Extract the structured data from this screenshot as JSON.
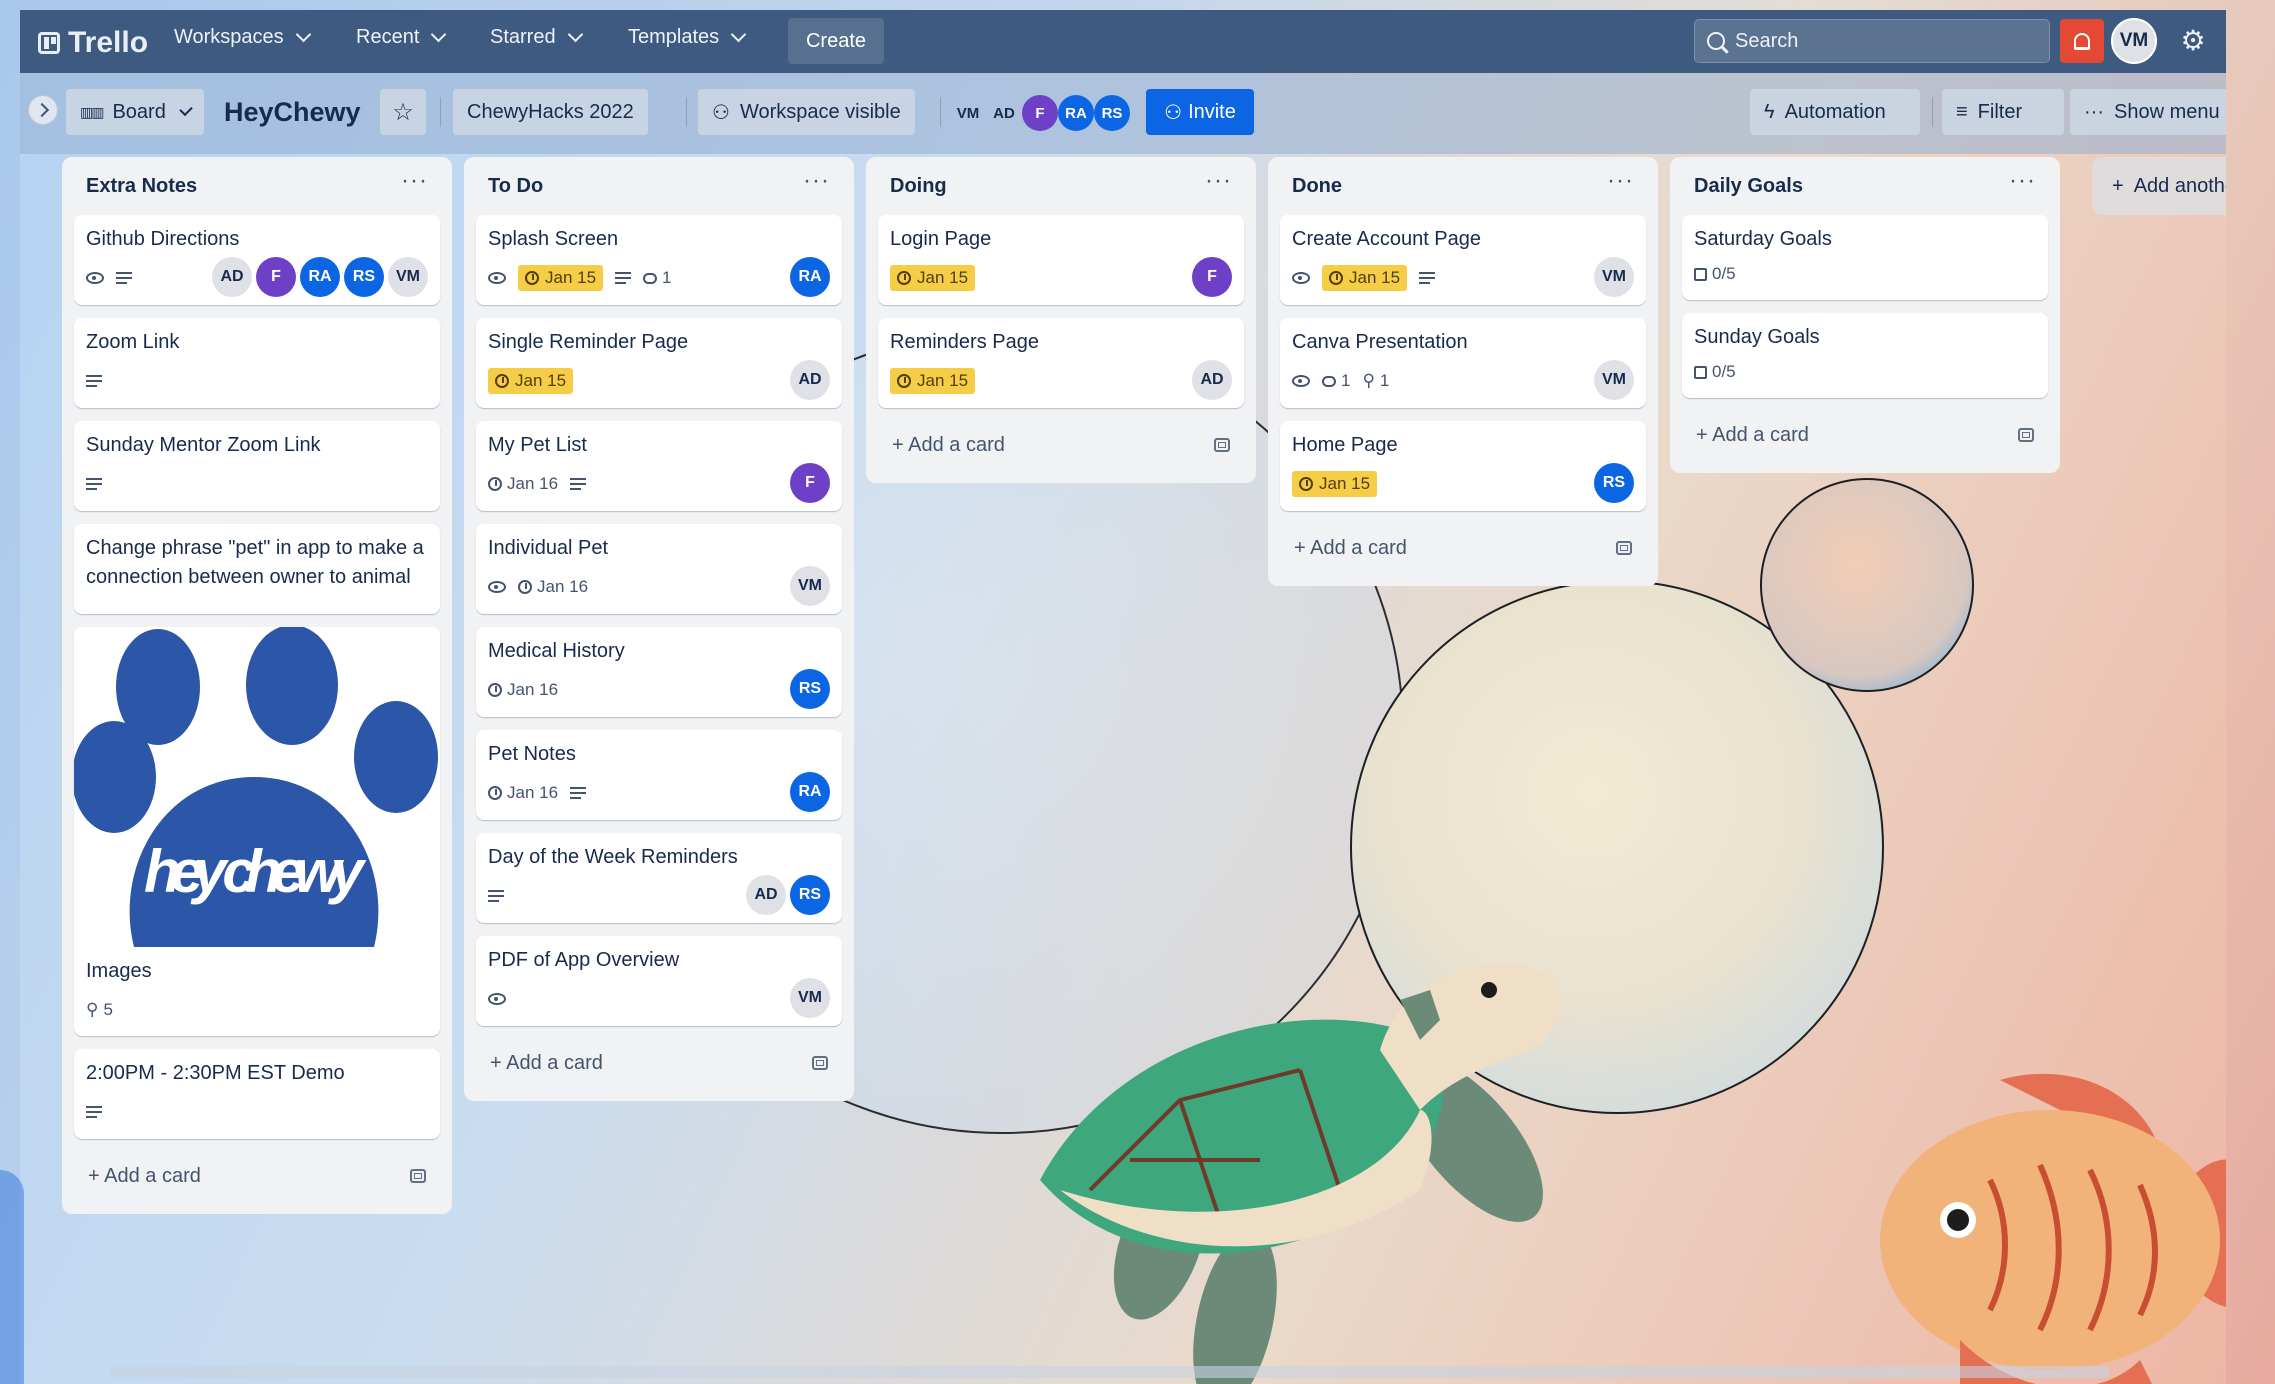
{
  "nav": {
    "logo": "Trello",
    "workspaces": "Workspaces",
    "recent": "Recent",
    "starred": "Starred",
    "templates": "Templates",
    "create": "Create",
    "search_placeholder": "Search",
    "avatar": "VM"
  },
  "board": {
    "view": "Board",
    "title": "HeyChewy",
    "workspace": "ChewyHacks 2022",
    "visibility": "Workspace visible",
    "members": [
      "VM",
      "AD",
      "F",
      "RA",
      "RS"
    ],
    "invite": "Invite",
    "automation": "Automation",
    "filter": "Filter",
    "show_menu": "Show menu"
  },
  "lists": [
    {
      "title": "Extra Notes",
      "cards": [
        {
          "title": "Github Directions",
          "members": [
            "AD",
            "F",
            "RA",
            "RS",
            "VM"
          ]
        },
        {
          "title": "Zoom Link"
        },
        {
          "title": "Sunday Mentor Zoom Link"
        },
        {
          "title": "Change phrase \"pet\" in app to make a connection between owner to animal"
        },
        {
          "title": "Images",
          "attachments": "5",
          "cover_text": "hey chewy"
        },
        {
          "title": "2:00PM - 2:30PM EST Demo"
        }
      ]
    },
    {
      "title": "To Do",
      "cards": [
        {
          "title": "Splash Screen",
          "date": "Jan 15",
          "comments": "1",
          "members": [
            "RA"
          ]
        },
        {
          "title": "Single Reminder Page",
          "date": "Jan 15",
          "members": [
            "AD"
          ]
        },
        {
          "title": "My Pet List",
          "date": "Jan 16",
          "members": [
            "F"
          ]
        },
        {
          "title": "Individual Pet",
          "date": "Jan 16",
          "members": [
            "VM"
          ]
        },
        {
          "title": "Medical History",
          "date": "Jan 16",
          "members": [
            "RS"
          ]
        },
        {
          "title": "Pet Notes",
          "date": "Jan 16",
          "members": [
            "RA"
          ]
        },
        {
          "title": "Day of the Week Reminders",
          "members": [
            "AD",
            "RS"
          ]
        },
        {
          "title": "PDF of App Overview",
          "members": [
            "VM"
          ]
        }
      ]
    },
    {
      "title": "Doing",
      "cards": [
        {
          "title": "Login Page",
          "date": "Jan 15",
          "members": [
            "F"
          ]
        },
        {
          "title": "Reminders Page",
          "date": "Jan 15",
          "members": [
            "AD"
          ]
        }
      ]
    },
    {
      "title": "Done",
      "cards": [
        {
          "title": "Create Account Page",
          "date": "Jan 15",
          "members": [
            "VM"
          ]
        },
        {
          "title": "Canva Presentation",
          "comments": "1",
          "attachments": "1",
          "members": [
            "VM"
          ]
        },
        {
          "title": "Home Page",
          "date": "Jan 15",
          "members": [
            "RS"
          ]
        }
      ]
    },
    {
      "title": "Daily Goals",
      "cards": [
        {
          "title": "Saturday Goals",
          "checklist": "0/5"
        },
        {
          "title": "Sunday Goals",
          "checklist": "0/5"
        }
      ]
    }
  ],
  "add_card": "Add a card",
  "add_list": "Add anothe",
  "colors": {
    "nav": "#3e5a80",
    "accent": "#0c66e4",
    "date_badge": "#f5cd47",
    "alert": "#e34935",
    "member_f": "#6e3fc7"
  }
}
